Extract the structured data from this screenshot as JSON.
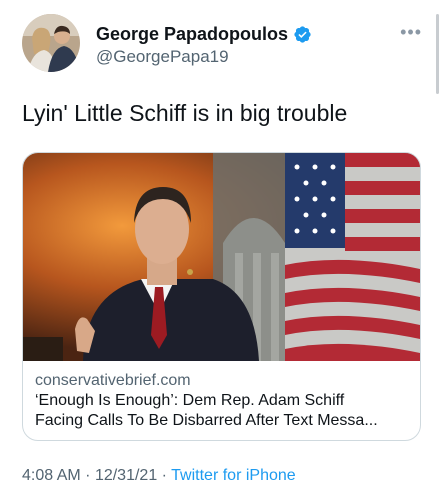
{
  "author": {
    "display_name": "George Papadopoulos",
    "handle": "@GeorgePapa19",
    "verified_icon": "verified-badge-icon"
  },
  "more_icon": "more-options-icon",
  "tweet": {
    "text": "Lyin' Little Schiff is in big trouble"
  },
  "link_card": {
    "domain": "conservativebrief.com",
    "title_line1": "‘Enough Is Enough’: Dem Rep. Adam Schiff",
    "title_line2": "Facing Calls To Be Disbarred After Text Messa..."
  },
  "footer": {
    "time": "4:08 AM",
    "date": "12/31/21",
    "separator": "·",
    "source": "Twitter for iPhone"
  },
  "colors": {
    "link_blue": "#1d9bf0",
    "secondary_text": "#536471",
    "border": "#cfd9de"
  }
}
